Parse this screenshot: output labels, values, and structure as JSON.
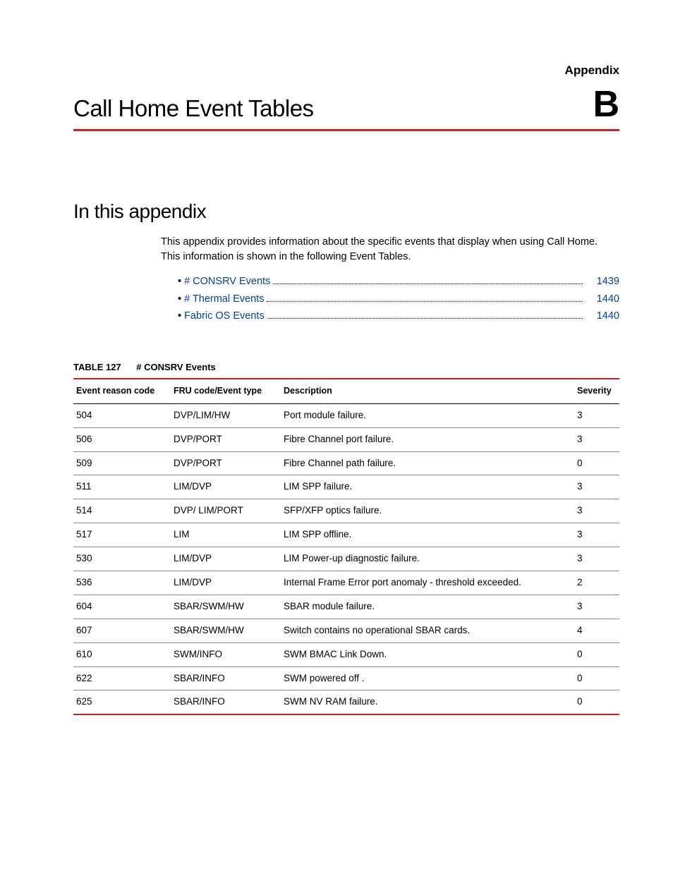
{
  "header": {
    "appendix_label": "Appendix",
    "page_title": "Call Home Event Tables",
    "appendix_letter": "B"
  },
  "section": {
    "heading": "In this appendix",
    "intro": "This appendix provides information about the specific events that display when using Call Home. This information is shown in the following Event Tables."
  },
  "toc": [
    {
      "label": "# CONSRV Events",
      "page": "1439"
    },
    {
      "label": "# Thermal Events",
      "page": "1440"
    },
    {
      "label": "Fabric OS Events",
      "page": "1440"
    }
  ],
  "table": {
    "caption_label": "TABLE 127",
    "caption_title": "# CONSRV Events",
    "headers": {
      "code": "Event reason code",
      "fru": "FRU code/Event type",
      "desc": "Description",
      "sev": "Severity"
    },
    "rows": [
      {
        "code": "504",
        "fru": "DVP/LIM/HW",
        "desc": "Port module failure.",
        "sev": "3"
      },
      {
        "code": "506",
        "fru": "DVP/PORT",
        "desc": "Fibre Channel port failure.",
        "sev": "3"
      },
      {
        "code": "509",
        "fru": "DVP/PORT",
        "desc": "Fibre Channel path failure.",
        "sev": "0"
      },
      {
        "code": "511",
        "fru": "LIM/DVP",
        "desc": "LIM SPP failure.",
        "sev": "3"
      },
      {
        "code": "514",
        "fru": "DVP/ LIM/PORT",
        "desc": "SFP/XFP optics failure.",
        "sev": "3"
      },
      {
        "code": "517",
        "fru": "LIM",
        "desc": "LIM SPP offline.",
        "sev": "3"
      },
      {
        "code": "530",
        "fru": "LIM/DVP",
        "desc": "LIM Power-up diagnostic failure.",
        "sev": "3"
      },
      {
        "code": "536",
        "fru": "LIM/DVP",
        "desc": "Internal Frame Error port anomaly - threshold exceeded.",
        "sev": "2"
      },
      {
        "code": "604",
        "fru": "SBAR/SWM/HW",
        "desc": "SBAR module failure.",
        "sev": "3"
      },
      {
        "code": "607",
        "fru": "SBAR/SWM/HW",
        "desc": "Switch contains no operational SBAR cards.",
        "sev": "4"
      },
      {
        "code": "610",
        "fru": "SWM/INFO",
        "desc": "SWM BMAC Link Down.",
        "sev": "0"
      },
      {
        "code": "622",
        "fru": "SBAR/INFO",
        "desc": "SWM powered off .",
        "sev": "0"
      },
      {
        "code": "625",
        "fru": "SBAR/INFO",
        "desc": "SWM NV RAM failure.",
        "sev": "0"
      }
    ]
  }
}
